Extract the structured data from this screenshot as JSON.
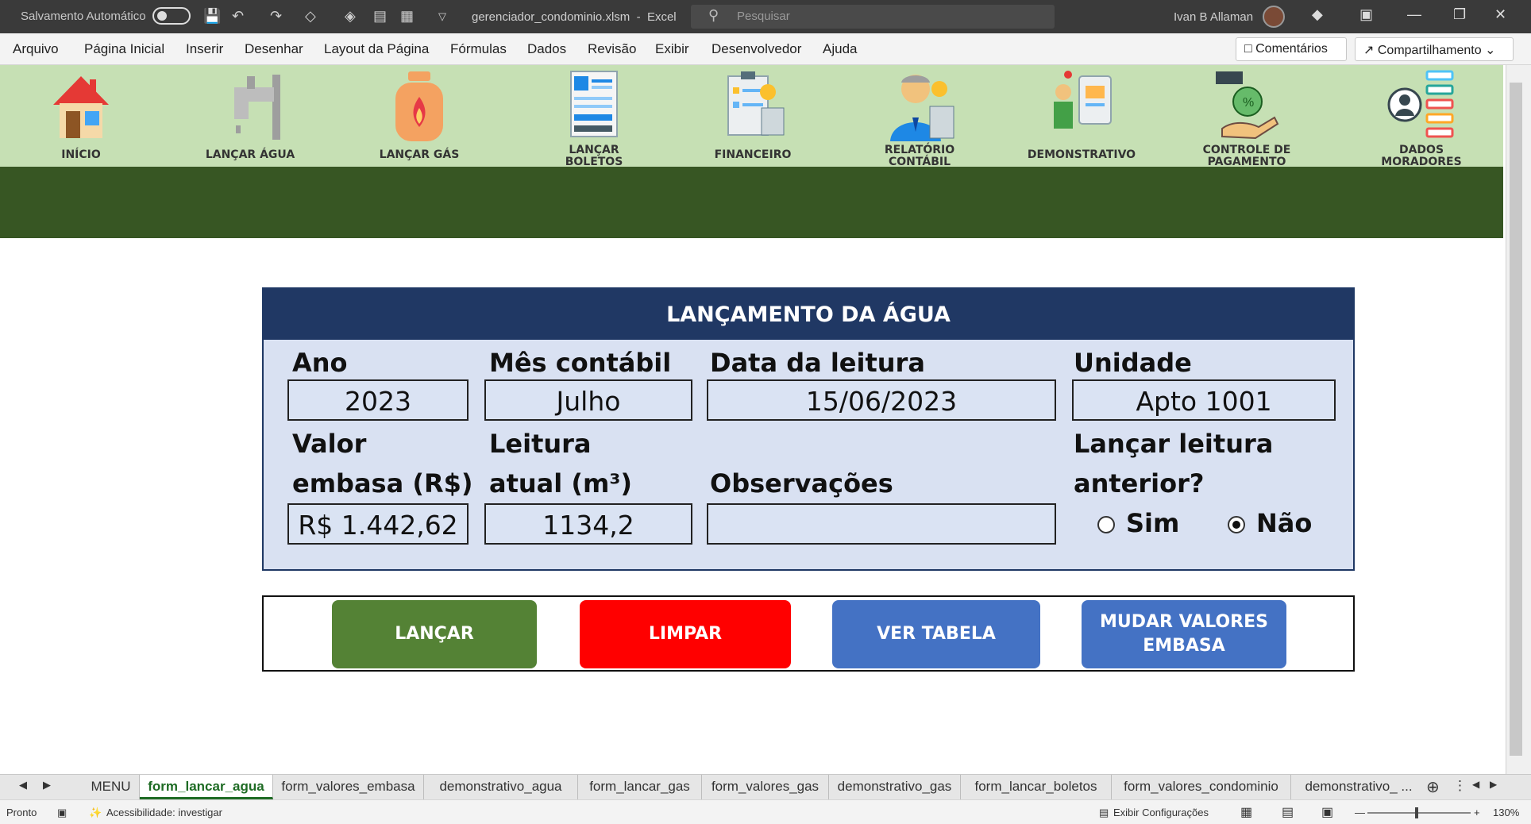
{
  "titlebar": {
    "autosave_label": "Salvamento Automático",
    "filename": "gerenciador_condominio.xlsm",
    "app": "Excel",
    "search_placeholder": "Pesquisar",
    "user": "Ivan B Allaman"
  },
  "menu": {
    "items": [
      "Arquivo",
      "Página Inicial",
      "Inserir",
      "Desenhar",
      "Layout da Página",
      "Fórmulas",
      "Dados",
      "Revisão",
      "Exibir",
      "Desenvolvedor",
      "Ajuda"
    ],
    "comments": "Comentários",
    "share": "Compartilhamento"
  },
  "nav": {
    "inicio": "INÍCIO",
    "agua": "LANÇAR ÁGUA",
    "gas": "LANÇAR GÁS",
    "boletos_1": "LANÇAR",
    "boletos_2": "BOLETOS",
    "financeiro": "FINANCEIRO",
    "relatorio_1": "RELATÓRIO",
    "relatorio_2": "CONTÁBIL",
    "demonstrativo": "DEMONSTRATIVO",
    "controle_1": "CONTROLE DE",
    "controle_2": "PAGAMENTO",
    "dados_1": "DADOS",
    "dados_2": "MORADORES"
  },
  "form": {
    "title": "LANÇAMENTO DA ÁGUA",
    "ano_label": "Ano",
    "ano_value": "2023",
    "mes_label": "Mês contábil",
    "mes_value": "Julho",
    "data_label": "Data da leitura",
    "data_value": "15/06/2023",
    "unidade_label": "Unidade",
    "unidade_value": "Apto 1001",
    "valor_label_1": "Valor",
    "valor_label_2": "embasa (R$)",
    "valor_value": "R$ 1.442,62",
    "leitura_label_1": "Leitura",
    "leitura_label_2": "atual (m³)",
    "leitura_value": "1134,2",
    "obs_label": "Observações",
    "obs_value": "",
    "anterior_label_1": "Lançar leitura",
    "anterior_label_2": "anterior?",
    "sim": "Sim",
    "nao": "Não",
    "selected": "Não"
  },
  "actions": {
    "lancar": "LANÇAR",
    "limpar": "LIMPAR",
    "ver_tabela": "VER TABELA",
    "mudar_1": "MUDAR VALORES",
    "mudar_2": "EMBASA"
  },
  "tabs": {
    "t0": "MENU",
    "t1": "form_lancar_agua",
    "t2": "form_valores_embasa",
    "t3": "demonstrativo_agua",
    "t4": "form_lancar_gas",
    "t5": "form_valores_gas",
    "t6": "demonstrativo_gas",
    "t7": "form_lancar_boletos",
    "t8": "form_valores_condominio",
    "t9": "demonstrativo_ ...",
    "active": "form_lancar_agua"
  },
  "status": {
    "ready": "Pronto",
    "accessibility": "Acessibilidade: investigar",
    "display_settings": "Exibir Configurações",
    "zoom": "130%"
  },
  "colors": {
    "nav_bg": "#c6e0b4",
    "dark_band": "#375623",
    "form_header": "#203864",
    "form_bg": "#d9e1f2",
    "btn_lancar": "#548235",
    "btn_limpar": "#ff0000",
    "btn_blue": "#4472c4"
  }
}
